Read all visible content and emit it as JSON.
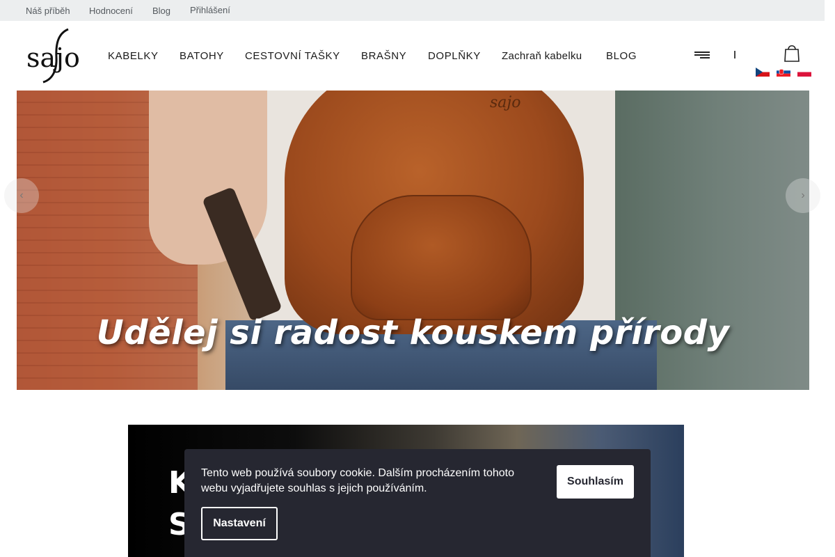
{
  "topbar": {
    "links": [
      "Náš příběh",
      "Hodnocení",
      "Blog",
      "Přihlášení"
    ]
  },
  "header": {
    "logo_text": "sajo",
    "nav": [
      "KABELKY",
      "BATOHY",
      "CESTOVNÍ TAŠKY",
      "BRAŠNY",
      "DOPLŇKY",
      "Zachraň kabelku",
      "BLOG"
    ],
    "icons": [
      "menu-icon",
      "search-icon",
      "shopping-bag-icon"
    ],
    "languages": [
      "cz-flag",
      "sk-flag",
      "pl-flag"
    ]
  },
  "hero": {
    "slogan": "Udělej si radost kouskem přírody",
    "brand_mark": "sajo",
    "prev_icon": "chevron-left-icon",
    "next_icon": "chevron-right-icon"
  },
  "promo": {
    "line1": "K",
    "line2": "S"
  },
  "cookie": {
    "message": "Tento web používá soubory cookie. Dalším procházením tohoto webu vyjadřujete souhlas s jejich používáním.",
    "agree_label": "Souhlasím",
    "settings_label": "Nastavení"
  },
  "colors": {
    "topbar_bg": "#eceeef",
    "cookie_bg": "#262731",
    "text_dark": "#1a1a1a"
  }
}
